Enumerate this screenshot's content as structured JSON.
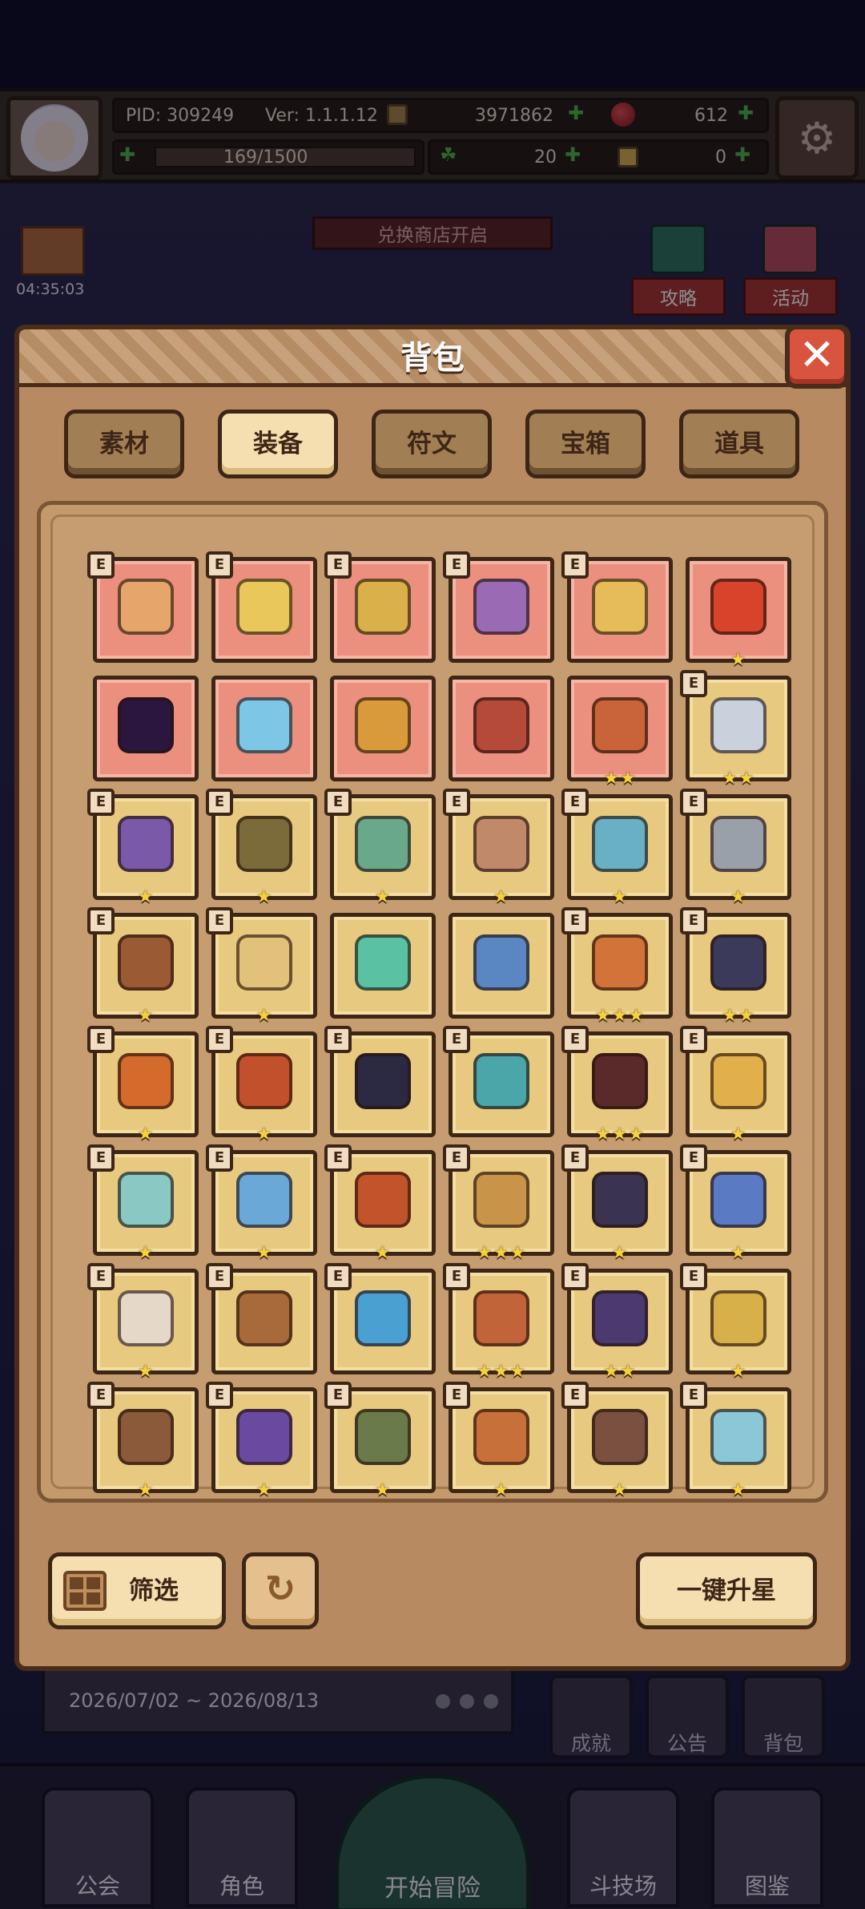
{
  "hud": {
    "pid": "PID: 309249",
    "version": "Ver: 1.1.1.12",
    "gold": "3971862",
    "gems": "612",
    "energy": "169/1500",
    "clovers": "20",
    "keys": "0"
  },
  "timer": "04:35:03",
  "banner": "兑换商店开启",
  "side_buttons": [
    "攻略",
    "活动"
  ],
  "event": {
    "date_range": "2026/07/02 ~ 2026/08/13"
  },
  "mini_buttons": [
    "成就",
    "公告",
    "背包"
  ],
  "bottom_nav": {
    "left": [
      "公会",
      "角色"
    ],
    "center": "开始冒险",
    "right": [
      "斗技场",
      "图鉴"
    ]
  },
  "modal": {
    "title": "背包",
    "close_icon": "close-icon",
    "tabs": [
      "素材",
      "装备",
      "符文",
      "宝箱",
      "道具"
    ],
    "active_tab": "装备",
    "filter_label": "筛选",
    "upgrade_label": "一键升星",
    "colors": {
      "pink_slot": "#eb8f7f",
      "gold_slot": "#e8c980",
      "star": "#f6d23a"
    }
  },
  "items": [
    {
      "name": "wooden-staff",
      "bg": "pink",
      "stars": 0,
      "color": "#e6a56a",
      "badge": "E"
    },
    {
      "name": "straw-hat",
      "bg": "pink",
      "stars": 0,
      "color": "#e9c75a",
      "badge": "E"
    },
    {
      "name": "heart-necklace",
      "bg": "pink",
      "stars": 0,
      "color": "#d9b04a",
      "badge": "E"
    },
    {
      "name": "chain-pendant",
      "bg": "pink",
      "stars": 0,
      "color": "#9a6bb4",
      "badge": "E"
    },
    {
      "name": "gold-ring",
      "bg": "pink",
      "stars": 0,
      "color": "#e6bb5a",
      "badge": "E"
    },
    {
      "name": "crossed-blades",
      "bg": "pink",
      "stars": 1,
      "color": "#d8432c",
      "badge": ""
    },
    {
      "name": "dark-orb",
      "bg": "pink",
      "stars": 0,
      "color": "#2b1640",
      "badge": ""
    },
    {
      "name": "ice-helmet",
      "bg": "pink",
      "stars": 0,
      "color": "#7ec6e6",
      "badge": ""
    },
    {
      "name": "horned-crown",
      "bg": "pink",
      "stars": 0,
      "color": "#d99a3c",
      "badge": ""
    },
    {
      "name": "red-cloak",
      "bg": "pink",
      "stars": 0,
      "color": "#b54a3a",
      "badge": ""
    },
    {
      "name": "copper-helm",
      "bg": "pink",
      "stars": 2,
      "color": "#c9643a",
      "badge": ""
    },
    {
      "name": "steel-sword",
      "bg": "gold",
      "stars": 2,
      "color": "#c9d2dc",
      "badge": "E"
    },
    {
      "name": "purple-mace",
      "bg": "gold",
      "stars": 1,
      "color": "#7a5aa8",
      "badge": "E"
    },
    {
      "name": "hunting-bow",
      "bg": "gold",
      "stars": 1,
      "color": "#7b6a3a",
      "badge": "E"
    },
    {
      "name": "jade-scepter",
      "bg": "gold",
      "stars": 1,
      "color": "#6aa88c",
      "badge": "E"
    },
    {
      "name": "battle-axe",
      "bg": "gold",
      "stars": 1,
      "color": "#c08a6a",
      "badge": "E"
    },
    {
      "name": "crystal-shield",
      "bg": "gold",
      "stars": 1,
      "color": "#6ab0c4",
      "badge": "E"
    },
    {
      "name": "dagger",
      "bg": "gold",
      "stars": 1,
      "color": "#9aa0aa",
      "badge": "E"
    },
    {
      "name": "barrel-shield",
      "bg": "gold",
      "stars": 1,
      "color": "#9a5a34",
      "badge": "E"
    },
    {
      "name": "gilded-shield",
      "bg": "gold",
      "stars": 1,
      "color": "#e2c27a",
      "badge": "E"
    },
    {
      "name": "jade-key",
      "bg": "gold",
      "stars": 0,
      "color": "#5ac2a2",
      "badge": ""
    },
    {
      "name": "magic-lamp",
      "bg": "gold",
      "stars": 0,
      "color": "#5a86c2",
      "badge": ""
    },
    {
      "name": "sun-amulet",
      "bg": "gold",
      "stars": 3,
      "color": "#d2743a",
      "badge": "E"
    },
    {
      "name": "winged-helm",
      "bg": "gold",
      "stars": 2,
      "color": "#3c3a5a",
      "badge": "E"
    },
    {
      "name": "horned-helmet",
      "bg": "gold",
      "stars": 1,
      "color": "#d46a2c",
      "badge": "E"
    },
    {
      "name": "crab-armor",
      "bg": "gold",
      "stars": 1,
      "color": "#c2502c",
      "badge": "E"
    },
    {
      "name": "shadow-helm",
      "bg": "gold",
      "stars": 0,
      "color": "#2c2a42",
      "badge": "E"
    },
    {
      "name": "visor-mask",
      "bg": "gold",
      "stars": 0,
      "color": "#4aa6a8",
      "badge": "E"
    },
    {
      "name": "dark-plate",
      "bg": "gold",
      "stars": 3,
      "color": "#5a2a2a",
      "badge": "E"
    },
    {
      "name": "gold-plate",
      "bg": "gold",
      "stars": 1,
      "color": "#e2b04a",
      "badge": "E"
    },
    {
      "name": "ice-pauldron",
      "bg": "gold",
      "stars": 1,
      "color": "#8ac8c4",
      "badge": "E"
    },
    {
      "name": "frost-armor",
      "bg": "gold",
      "stars": 1,
      "color": "#6aa8d8",
      "badge": "E"
    },
    {
      "name": "phoenix-plate",
      "bg": "gold",
      "stars": 1,
      "color": "#c2542c",
      "badge": "E"
    },
    {
      "name": "ruby-gauntlet",
      "bg": "gold",
      "stars": 3,
      "color": "#c8944a",
      "badge": "E"
    },
    {
      "name": "demon-armor",
      "bg": "gold",
      "stars": 1,
      "color": "#3a3450",
      "badge": "E"
    },
    {
      "name": "sapphire-bracer",
      "bg": "gold",
      "stars": 1,
      "color": "#5a7ac4",
      "badge": "E"
    },
    {
      "name": "feather-charm",
      "bg": "gold",
      "stars": 1,
      "color": "#e6d8c8",
      "badge": "E"
    },
    {
      "name": "bronze-horn",
      "bg": "gold",
      "stars": 0,
      "color": "#a86a3a",
      "badge": "E"
    },
    {
      "name": "ice-glove",
      "bg": "gold",
      "stars": 0,
      "color": "#4aa0d0",
      "badge": "E"
    },
    {
      "name": "ruby-belt",
      "bg": "gold",
      "stars": 3,
      "color": "#c2643a",
      "badge": "E"
    },
    {
      "name": "amethyst-crown",
      "bg": "gold",
      "stars": 2,
      "color": "#4a3a70",
      "badge": "E"
    },
    {
      "name": "golden-band",
      "bg": "gold",
      "stars": 1,
      "color": "#d8b04a",
      "badge": "E"
    },
    {
      "name": "emerald-bangle",
      "bg": "gold",
      "stars": 1,
      "color": "#8a5a3a",
      "badge": "E"
    },
    {
      "name": "void-ring",
      "bg": "gold",
      "stars": 1,
      "color": "#6a4aa0",
      "badge": "E"
    },
    {
      "name": "moss-band",
      "bg": "gold",
      "stars": 1,
      "color": "#6a7a4a",
      "badge": "E"
    },
    {
      "name": "bronze-gorget",
      "bg": "gold",
      "stars": 1,
      "color": "#c8703a",
      "badge": "E"
    },
    {
      "name": "pearl-ring",
      "bg": "gold",
      "stars": 1,
      "color": "#7a5040",
      "badge": "E"
    },
    {
      "name": "crystal-crown",
      "bg": "gold",
      "stars": 1,
      "color": "#8ac8d8",
      "badge": "E"
    }
  ]
}
